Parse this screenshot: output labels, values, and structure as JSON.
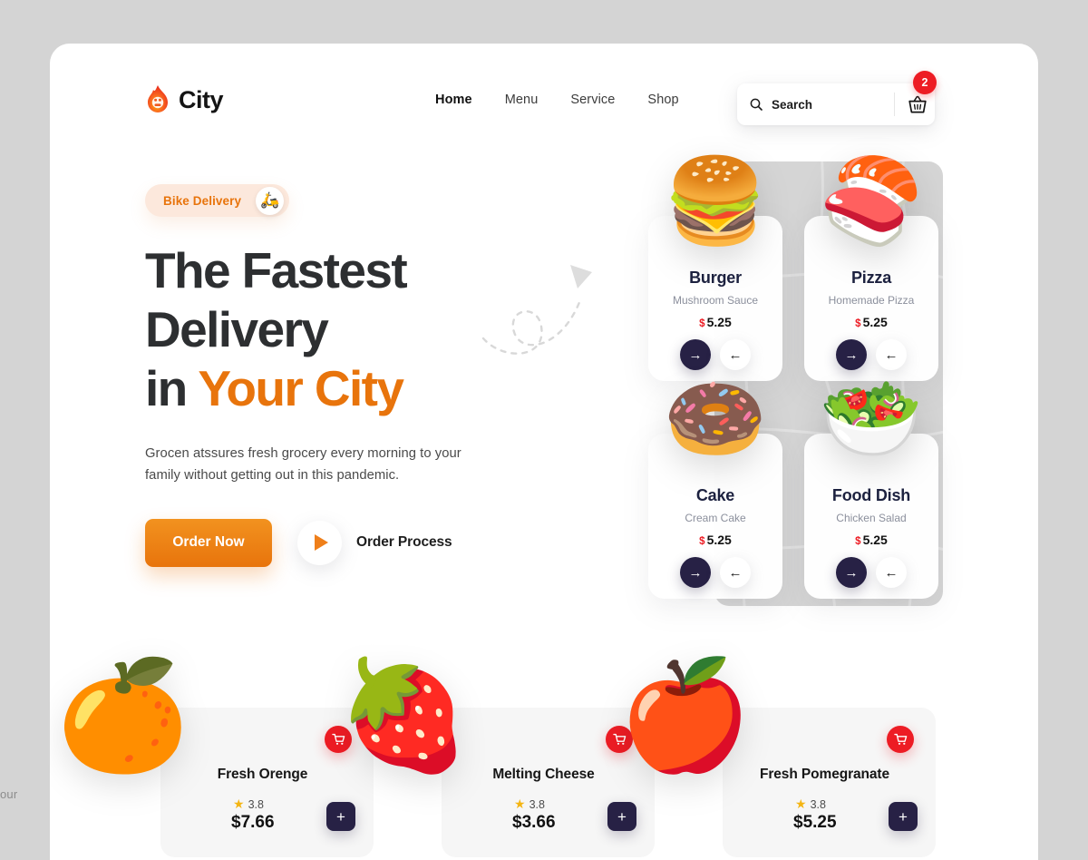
{
  "brand": {
    "name": "City",
    "logo_icon": "flame-icon"
  },
  "nav": {
    "items": [
      {
        "label": "Home",
        "active": true
      },
      {
        "label": "Menu",
        "active": false
      },
      {
        "label": "Service",
        "active": false
      },
      {
        "label": "Shop",
        "active": false
      }
    ]
  },
  "search": {
    "placeholder": "Search",
    "value": "",
    "icon": "search-icon"
  },
  "cart": {
    "icon": "shopping-basket-icon",
    "badge_count": "2",
    "badge_color": "#ed1c24"
  },
  "hero": {
    "pill": {
      "label": "Bike Delivery",
      "icon": "delivery-scooter-icon"
    },
    "headline_line1": "The Fastest",
    "headline_line2": "Delivery",
    "headline_line3_plain": "in ",
    "headline_line3_accent": "Your City",
    "paragraph": "Grocen atssures fresh grocery every morning to your family without getting out in this pandemic.",
    "primary_button": "Order Now",
    "secondary_button": "Order Process",
    "secondary_icon": "play-icon",
    "accent_color": "#e8740c",
    "heading_color": "#2d2f31"
  },
  "food_cards": [
    {
      "title": "Burger",
      "subtitle": "Mushroom Sauce",
      "currency": "$",
      "price": "5.25",
      "emoji": "🍔",
      "next_icon": "arrow-right-icon",
      "prev_icon": "arrow-left-icon"
    },
    {
      "title": "Pizza",
      "subtitle": "Homemade Pizza",
      "currency": "$",
      "price": "5.25",
      "emoji": "🍣",
      "next_icon": "arrow-right-icon",
      "prev_icon": "arrow-left-icon"
    },
    {
      "title": "Cake",
      "subtitle": "Cream Cake",
      "currency": "$",
      "price": "5.25",
      "emoji": "🍩",
      "next_icon": "arrow-right-icon",
      "prev_icon": "arrow-left-icon"
    },
    {
      "title": "Food Dish",
      "subtitle": "Chicken Salad",
      "currency": "$",
      "price": "5.25",
      "emoji": "🥗",
      "next_icon": "arrow-right-icon",
      "prev_icon": "arrow-left-icon"
    }
  ],
  "products": [
    {
      "title": "Fresh Orenge",
      "rating": "3.8",
      "price": "$7.66",
      "emoji": "🍊",
      "cart_icon": "shopping-cart-icon",
      "add_label": "+"
    },
    {
      "title": "Melting Cheese",
      "rating": "3.8",
      "price": "$3.66",
      "emoji": "🍓",
      "cart_icon": "shopping-cart-icon",
      "add_label": "+"
    },
    {
      "title": "Fresh Pomegranate",
      "rating": "3.8",
      "price": "$5.25",
      "emoji": "🍎",
      "cart_icon": "shopping-cart-icon",
      "add_label": "+"
    }
  ],
  "page_edge_text": "our"
}
